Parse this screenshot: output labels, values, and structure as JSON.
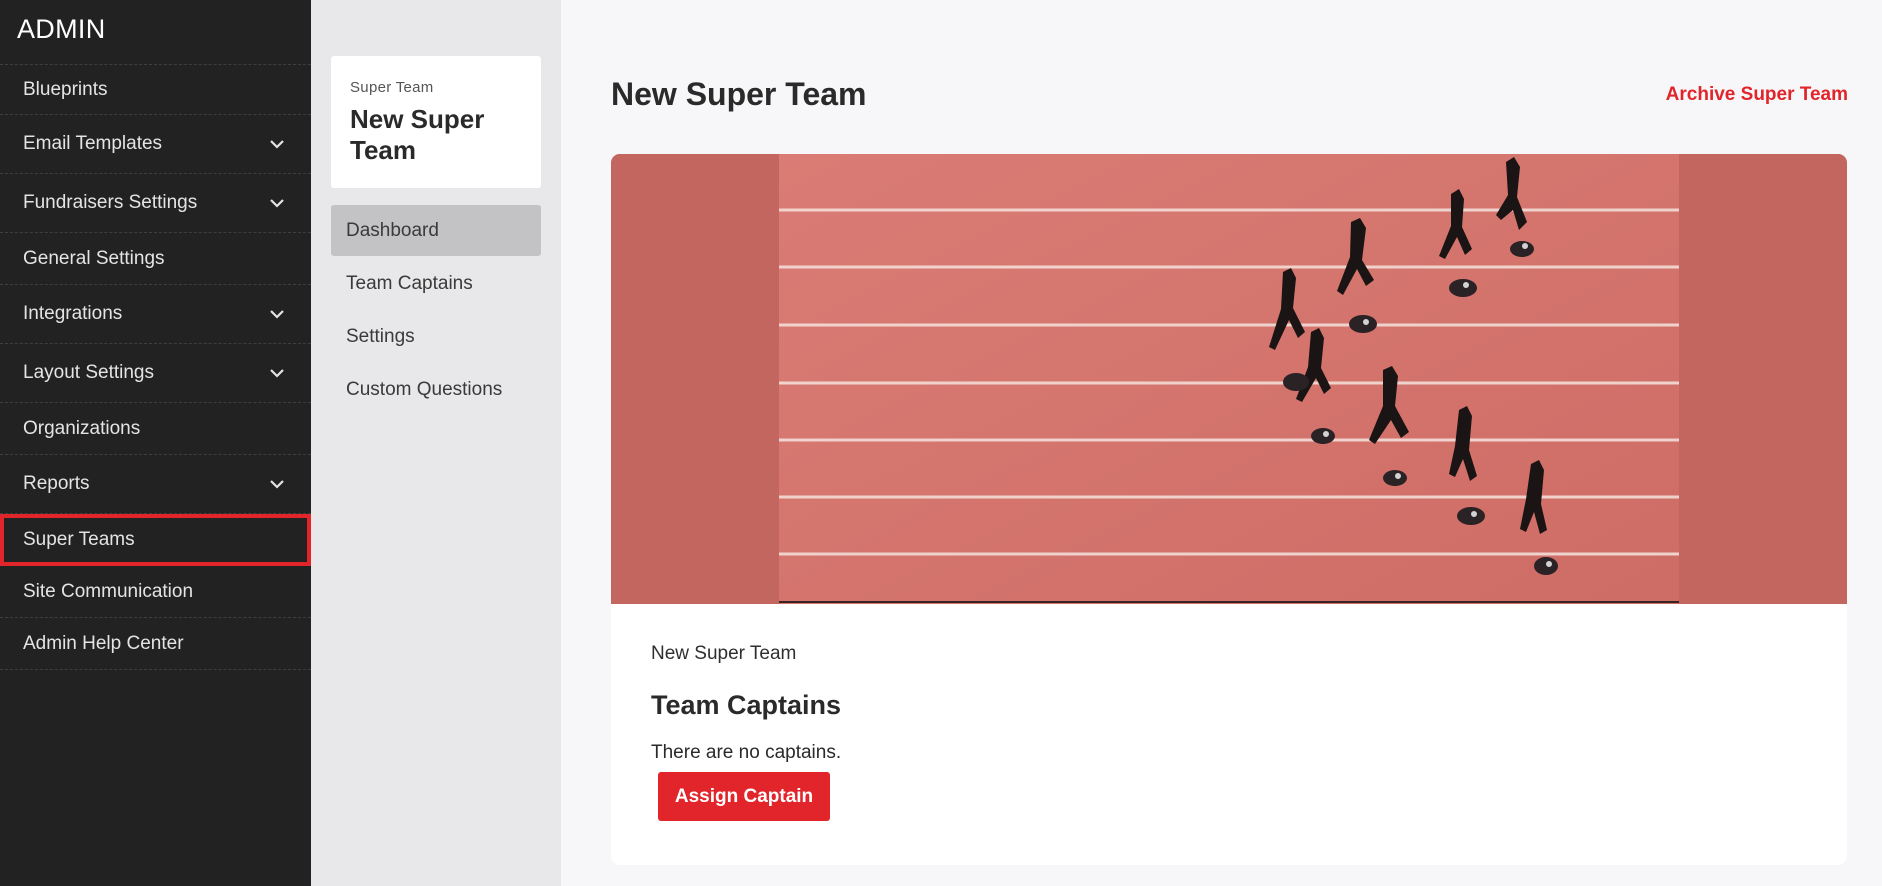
{
  "admin": {
    "title": "ADMIN",
    "nav": [
      {
        "label": "Blueprints",
        "expandable": false
      },
      {
        "label": "Email Templates",
        "expandable": true
      },
      {
        "label": "Fundraisers Settings",
        "expandable": true
      },
      {
        "label": "General Settings",
        "expandable": false
      },
      {
        "label": "Integrations",
        "expandable": true
      },
      {
        "label": "Layout Settings",
        "expandable": true
      },
      {
        "label": "Organizations",
        "expandable": false
      },
      {
        "label": "Reports",
        "expandable": true
      },
      {
        "label": "Super Teams",
        "expandable": false,
        "active": true
      },
      {
        "label": "Site Communication",
        "expandable": false
      },
      {
        "label": "Admin Help Center",
        "expandable": false
      }
    ]
  },
  "team_card": {
    "label": "Super Team",
    "name": "New Super Team"
  },
  "sub_nav": [
    {
      "label": "Dashboard",
      "selected": true
    },
    {
      "label": "Team Captains",
      "selected": false
    },
    {
      "label": "Settings",
      "selected": false
    },
    {
      "label": "Custom Questions",
      "selected": false
    }
  ],
  "main": {
    "title": "New Super Team",
    "archive_label": "Archive Super Team",
    "banner_alt": "aerial-running-track-image",
    "team_name": "New Super Team",
    "captains_heading": "Team Captains",
    "no_captains_text": "There are no captains.",
    "assign_button": "Assign Captain"
  },
  "colors": {
    "sidebar_bg": "#222222",
    "accent_red": "#e1252a",
    "track": "#c76b64"
  }
}
